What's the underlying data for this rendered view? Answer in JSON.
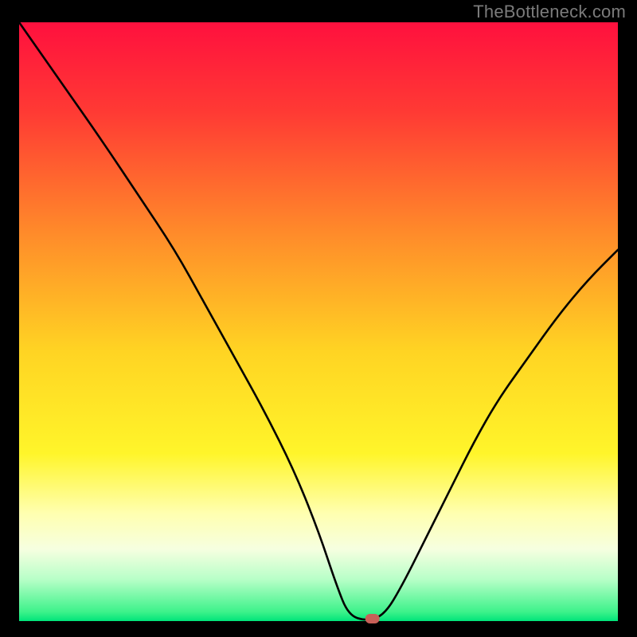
{
  "watermark": "TheBottleneck.com",
  "chart_data": {
    "type": "line",
    "title": "",
    "xlabel": "",
    "ylabel": "",
    "xlim": [
      0,
      100
    ],
    "ylim": [
      0,
      100
    ],
    "curve": [
      {
        "x": 0,
        "y": 100
      },
      {
        "x": 7,
        "y": 90
      },
      {
        "x": 14,
        "y": 80
      },
      {
        "x": 20,
        "y": 71
      },
      {
        "x": 26,
        "y": 62
      },
      {
        "x": 31,
        "y": 53
      },
      {
        "x": 36,
        "y": 44
      },
      {
        "x": 41,
        "y": 35
      },
      {
        "x": 46,
        "y": 25
      },
      {
        "x": 50,
        "y": 15
      },
      {
        "x": 53,
        "y": 6
      },
      {
        "x": 55,
        "y": 1
      },
      {
        "x": 58,
        "y": 0
      },
      {
        "x": 61,
        "y": 1
      },
      {
        "x": 64,
        "y": 6
      },
      {
        "x": 68,
        "y": 14
      },
      {
        "x": 72,
        "y": 22
      },
      {
        "x": 76,
        "y": 30
      },
      {
        "x": 80,
        "y": 37
      },
      {
        "x": 85,
        "y": 44
      },
      {
        "x": 90,
        "y": 51
      },
      {
        "x": 95,
        "y": 57
      },
      {
        "x": 100,
        "y": 62
      }
    ],
    "marker": {
      "x": 59,
      "y": 0
    },
    "gradient_stops": [
      {
        "offset": 0.0,
        "color": "#ff103e"
      },
      {
        "offset": 0.15,
        "color": "#ff3a34"
      },
      {
        "offset": 0.35,
        "color": "#ff8a2a"
      },
      {
        "offset": 0.55,
        "color": "#ffd423"
      },
      {
        "offset": 0.72,
        "color": "#fff52a"
      },
      {
        "offset": 0.82,
        "color": "#ffffb0"
      },
      {
        "offset": 0.88,
        "color": "#f6ffe0"
      },
      {
        "offset": 0.93,
        "color": "#b8ffc8"
      },
      {
        "offset": 0.985,
        "color": "#3cf28a"
      },
      {
        "offset": 1.0,
        "color": "#00e47a"
      }
    ],
    "marker_color": "#c86058",
    "curve_color": "#000000"
  }
}
